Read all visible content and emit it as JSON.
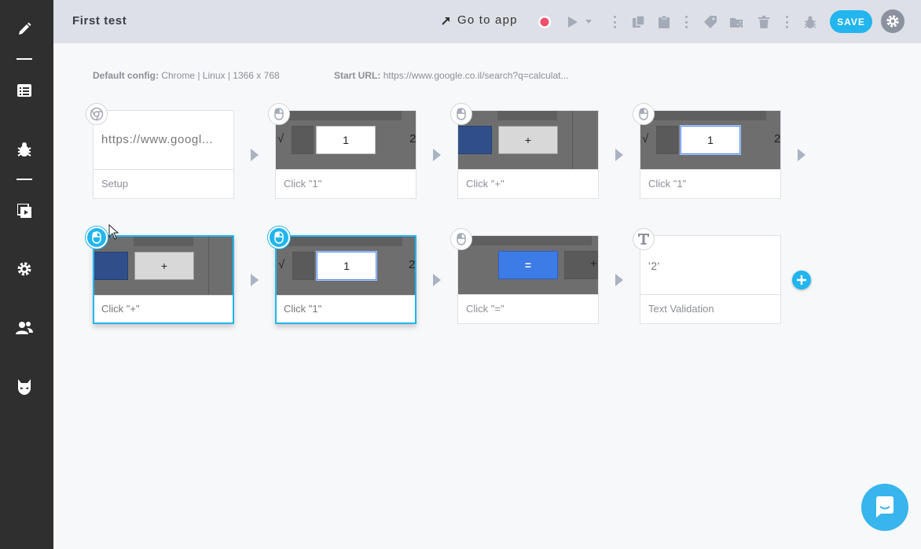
{
  "topbar": {
    "title": "First test",
    "go_to_app": "Go to app",
    "save_label": "SAVE"
  },
  "config": {
    "default_label": "Default config:",
    "default_value": "Chrome | Linux | 1366 x 768",
    "start_label": "Start URL:",
    "start_value": "https://www.google.co.il/search?q=calculat..."
  },
  "steps": [
    {
      "caption": "Setup",
      "body_text": "https://www.googl...",
      "badge": "chrome-icon"
    },
    {
      "caption": "Click \"1\"",
      "badge": "mouse-icon"
    },
    {
      "caption": "Click \"+\"",
      "badge": "mouse-icon"
    },
    {
      "caption": "Click \"1\"",
      "badge": "mouse-icon"
    },
    {
      "caption": "Click \"+\"",
      "badge": "mouse-icon",
      "selected": true
    },
    {
      "caption": "Click \"1\"",
      "badge": "mouse-icon",
      "selected": true
    },
    {
      "caption": "Click \"=\"",
      "badge": "mouse-icon"
    },
    {
      "caption": "Text Validation",
      "body_text": "'2'",
      "badge": "text-t-icon"
    }
  ],
  "thumb_text": {
    "one": "1",
    "plus": "+",
    "equals": "=",
    "two": "2",
    "sqrt": "√"
  },
  "colors": {
    "accent": "#22b5ee",
    "sidebar": "#2f2f2f",
    "topbar": "#dde0e7",
    "record": "#f0506e"
  }
}
